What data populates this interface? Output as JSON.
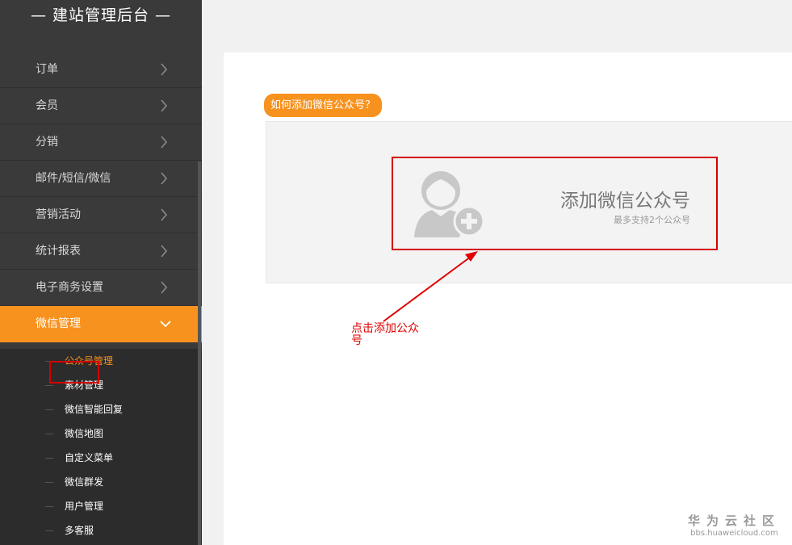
{
  "sidebar": {
    "title": "— 建站管理后台 —",
    "items": [
      {
        "label": "订单"
      },
      {
        "label": "会员"
      },
      {
        "label": "分销"
      },
      {
        "label": "邮件/短信/微信"
      },
      {
        "label": "营销活动"
      },
      {
        "label": "统计报表"
      },
      {
        "label": "电子商务设置"
      },
      {
        "label": "微信管理"
      }
    ],
    "submenu": [
      {
        "label": "公众号管理"
      },
      {
        "label": "素材管理"
      },
      {
        "label": "微信智能回复"
      },
      {
        "label": "微信地图"
      },
      {
        "label": "自定义菜单"
      },
      {
        "label": "微信群发"
      },
      {
        "label": "用户管理"
      },
      {
        "label": "多客服"
      }
    ]
  },
  "main": {
    "help_label": "如何添加微信公众号？",
    "add_title": "添加微信公众号",
    "add_subtitle": "最多支持2个公众号",
    "annotation": "点击添加公众号"
  },
  "watermark": {
    "title": "华为云社区",
    "url": "bbs.huaweicloud.com"
  },
  "colors": {
    "accent": "#f7921e",
    "sidebar_bg": "#3a3a3a",
    "highlight_red": "#d40000"
  }
}
